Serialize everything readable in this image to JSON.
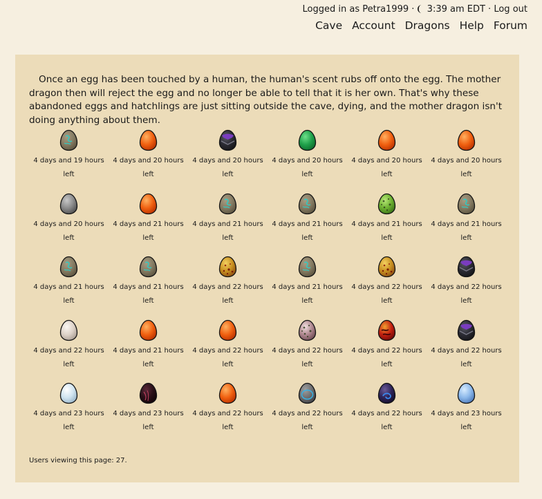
{
  "header": {
    "logged_in_text": "Logged in as Petra1999 ·",
    "time_text": "3:39 am EDT ·",
    "logout_label": "Log out",
    "moon_icon": "moon-icon",
    "nav": [
      "Cave",
      "Account",
      "Dragons",
      "Help",
      "Forum"
    ]
  },
  "intro": "Once an egg has been touched by a human, the human's scent rubs off onto the egg. The mother dragon then will reject the egg and no longer be able to tell that it is her own. That's why these abandoned eggs and hatchlings are just sitting outside the cave, dying, and the mother dragon isn't doing anything about them.",
  "eggs": [
    {
      "type": "teal-swirl",
      "time": "4 days and 19 hours left"
    },
    {
      "type": "orange",
      "time": "4 days and 20 hours left"
    },
    {
      "type": "purple-black",
      "time": "4 days and 20 hours left"
    },
    {
      "type": "green",
      "time": "4 days and 20 hours left"
    },
    {
      "type": "orange",
      "time": "4 days and 20 hours left"
    },
    {
      "type": "orange",
      "time": "4 days and 20 hours left"
    },
    {
      "type": "grey",
      "time": "4 days and 20 hours left"
    },
    {
      "type": "orange",
      "time": "4 days and 21 hours left"
    },
    {
      "type": "teal-swirl",
      "time": "4 days and 21 hours left"
    },
    {
      "type": "teal-swirl",
      "time": "4 days and 21 hours left"
    },
    {
      "type": "green-spotted",
      "time": "4 days and 21 hours left"
    },
    {
      "type": "teal-swirl",
      "time": "4 days and 21 hours left"
    },
    {
      "type": "teal-swirl",
      "time": "4 days and 21 hours left"
    },
    {
      "type": "teal-swirl",
      "time": "4 days and 21 hours left"
    },
    {
      "type": "gold-speckled",
      "time": "4 days and 22 hours left"
    },
    {
      "type": "teal-swirl",
      "time": "4 days and 21 hours left"
    },
    {
      "type": "gold-speckled",
      "time": "4 days and 22 hours left"
    },
    {
      "type": "purple-black",
      "time": "4 days and 22 hours left"
    },
    {
      "type": "cream",
      "time": "4 days and 22 hours left"
    },
    {
      "type": "orange",
      "time": "4 days and 21 hours left"
    },
    {
      "type": "orange",
      "time": "4 days and 22 hours left"
    },
    {
      "type": "pink-speckled",
      "time": "4 days and 22 hours left"
    },
    {
      "type": "red-flame",
      "time": "4 days and 22 hours left"
    },
    {
      "type": "purple-black",
      "time": "4 days and 22 hours left"
    },
    {
      "type": "white-blue",
      "time": "4 days and 23 hours left"
    },
    {
      "type": "dark-red",
      "time": "4 days and 23 hours left"
    },
    {
      "type": "orange",
      "time": "4 days and 22 hours left"
    },
    {
      "type": "blue-ring",
      "time": "4 days and 22 hours left"
    },
    {
      "type": "navy-swirl",
      "time": "4 days and 22 hours left"
    },
    {
      "type": "light-blue",
      "time": "4 days and 23 hours left"
    }
  ],
  "footer": {
    "viewers": "Users viewing this page: 27."
  }
}
